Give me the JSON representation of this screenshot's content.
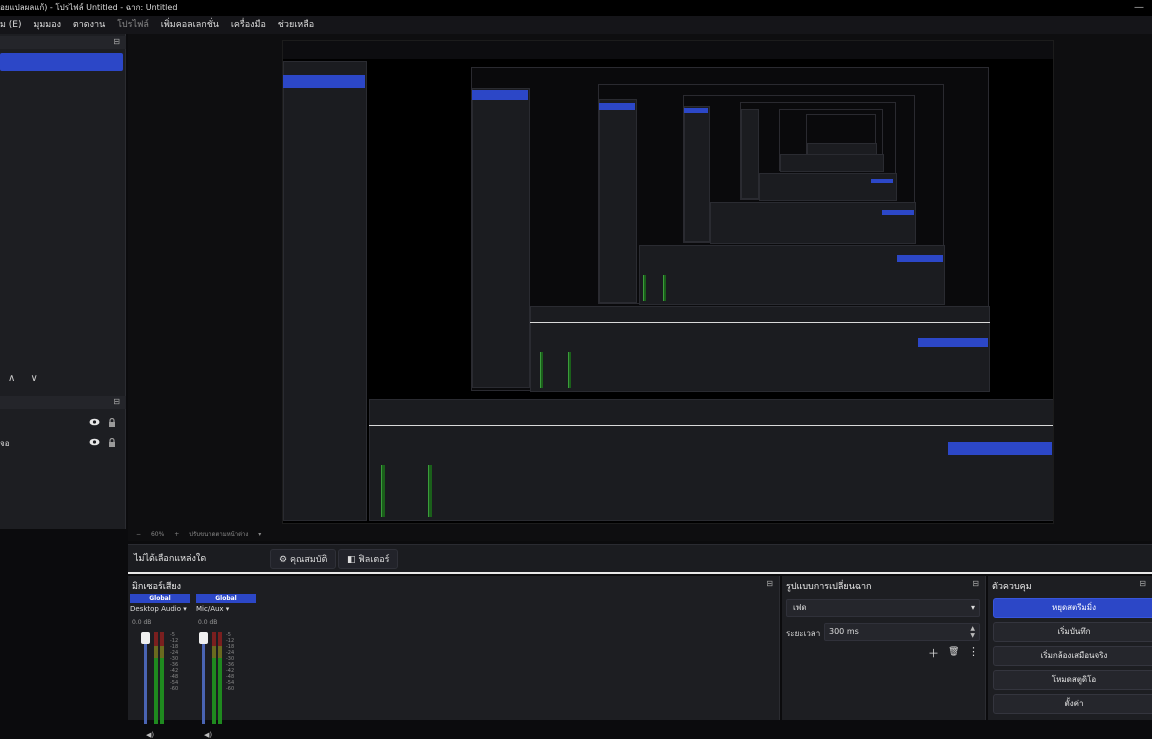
{
  "window": {
    "title": "อยแปลผลแก้) - โปรไฟล์ Untitled - ฉาก: Untitled",
    "controls": "—"
  },
  "menubar": {
    "items": [
      "ม (E)",
      "มุมมอง",
      "ตาดงาน",
      "โปรไฟล์",
      "เพิ่มคอลเลกชั่น",
      "เครื่องมือ",
      "ช่วยเหลือ"
    ]
  },
  "left_panel": {
    "dock_icon": "⊟",
    "arrows": "∧ ∨",
    "sources": [
      {
        "label": ""
      },
      {
        "label": "จอ"
      }
    ]
  },
  "zoom_bar": {
    "minus": "−",
    "zoom": "60%",
    "plus": "+",
    "mode": "ปรับขนาดตามหน้าต่าง",
    "arrow": "▾"
  },
  "context_bar": {
    "no_source": "ไม่ได้เลือกแหล่งใด",
    "properties": "คุณสมบัติ",
    "filters": "ฟิลเตอร์"
  },
  "mixer": {
    "title": "มิกเซอร์เสียง",
    "channels": [
      {
        "badge": "Global",
        "name": "Desktop Audio",
        "db": "0.0 dB"
      },
      {
        "badge": "Global",
        "name": "Mic/Aux",
        "db": "0.0 dB"
      }
    ],
    "scale": [
      "-5",
      "-12",
      "-18",
      "-24",
      "-30",
      "-36",
      "-42",
      "-48",
      "-54",
      "-60"
    ]
  },
  "transitions": {
    "title": "รูปแบบการเปลี่ยนฉาก",
    "selected": "เฟด",
    "duration_label": "ระยะเวลา",
    "duration_value": "300 ms"
  },
  "controls": {
    "title": "ตัวควบคุม",
    "buttons": [
      "หยุดสตรีมมิ่ง",
      "เริ่มบันทึก",
      "เริ่มกล้องเสมือนจริง",
      "โหมดสตูดิโอ",
      "ตั้งค่า"
    ]
  },
  "colors": {
    "accent": "#2c47c7",
    "panel": "#1d1e22",
    "background": "#0b0b0d"
  }
}
